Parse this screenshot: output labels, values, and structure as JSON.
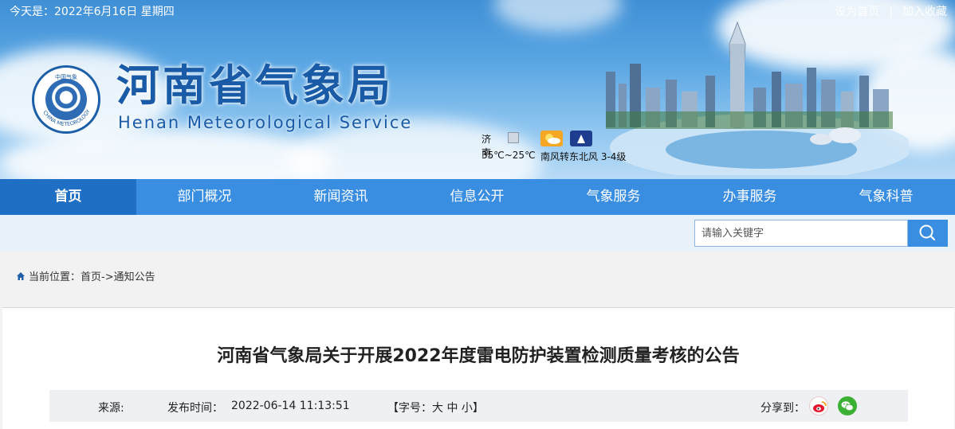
{
  "header": {
    "date_text": "今天是：2022年6月16日 星期四",
    "set_home": "设为首页",
    "separator": "|",
    "add_favorite": "加入收藏",
    "site_title": "河南省气象局",
    "site_subtitle": "Henan  Meteorological Service",
    "logo_ring_text": "CHINA METEOROLOGY",
    "logo_top_text": "中国气象"
  },
  "weather": {
    "city": "济南",
    "temp": "35℃~25℃",
    "wind": "南风转东北风 3-4级",
    "icons": [
      "sunny-cloudy-icon",
      "night-clear-icon"
    ]
  },
  "nav": {
    "items": [
      "首页",
      "部门概况",
      "新闻资讯",
      "信息公开",
      "气象服务",
      "办事服务",
      "气象科普"
    ],
    "active_index": 0
  },
  "search": {
    "placeholder": "请输入关键字"
  },
  "breadcrumb": {
    "label": "当前位置：",
    "path": "首页->通知公告"
  },
  "article": {
    "title": "河南省气象局关于开展2022年度雷电防护装置检测质量考核的公告",
    "source_label": "来源:",
    "publish_label": "发布时间：",
    "publish_time": "2022-06-14 11:13:51",
    "fontsize_prefix": "【字号：",
    "fontsize_large": "大",
    "fontsize_medium": "中",
    "fontsize_small": "小",
    "fontsize_suffix": "】",
    "share_label": "分享到："
  },
  "colors": {
    "brand_blue": "#1a5ba8",
    "nav_blue": "#3a8ee2",
    "nav_active": "#1f6fc5",
    "weibo_red": "#e6162d",
    "wechat_green": "#3cb034"
  }
}
